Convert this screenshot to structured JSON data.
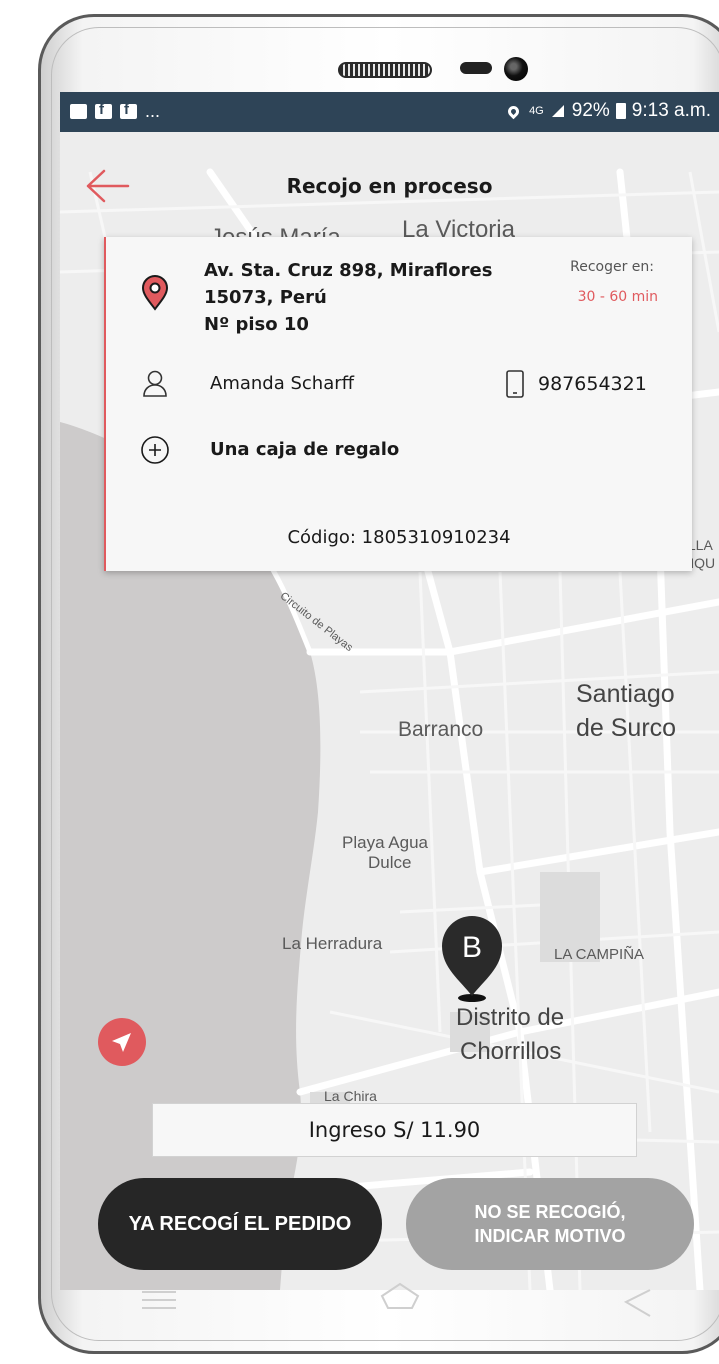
{
  "status_bar": {
    "dots": "...",
    "network": "4G",
    "battery": "92%",
    "time": "9:13 a.m."
  },
  "header": {
    "title": "Recojo en proceso"
  },
  "map_labels": {
    "jesus_maria": "Jesús María",
    "la_victoria": "La Victoria",
    "circuito": "Circuito de Playas",
    "santiago_1": "Santiago",
    "santiago_2": "de Surco",
    "barranco": "Barranco",
    "playa_1": "Playa Agua",
    "playa_2": "Dulce",
    "herradura": "La Herradura",
    "campina": "LA CAMPIÑA",
    "chorrillos_1": "Distrito de",
    "chorrillos_2": "Chorrillos",
    "edge_1": "ILLA",
    "edge_2": "NQU",
    "chira": "La Chira",
    "marker": "B"
  },
  "card": {
    "address_line1": "Av. Sta. Cruz 898, Miraflores",
    "address_line2": "15073, Perú",
    "address_line3": "Nº piso 10",
    "pickup_label": "Recoger en:",
    "pickup_time": "30 - 60 min",
    "person_name": "Amanda Scharff",
    "phone": "987654321",
    "item": "Una caja de regalo",
    "code": "Código: 1805310910234"
  },
  "income": "Ingreso S/ 11.90",
  "buttons": {
    "picked_up": "YA RECOGÍ EL PEDIDO",
    "not_picked_1": "NO SE RECOGIÓ,",
    "not_picked_2": "INDICAR MOTIVO"
  },
  "colors": {
    "accent": "#e05a5e",
    "status_bar": "#2e4457",
    "dark_button": "#262626",
    "gray_button": "#a3a3a3"
  },
  "icons": [
    "back-arrow-icon",
    "location-pin-icon",
    "person-icon",
    "phone-icon",
    "plus-circle-icon",
    "navigate-icon",
    "map-marker-icon"
  ]
}
